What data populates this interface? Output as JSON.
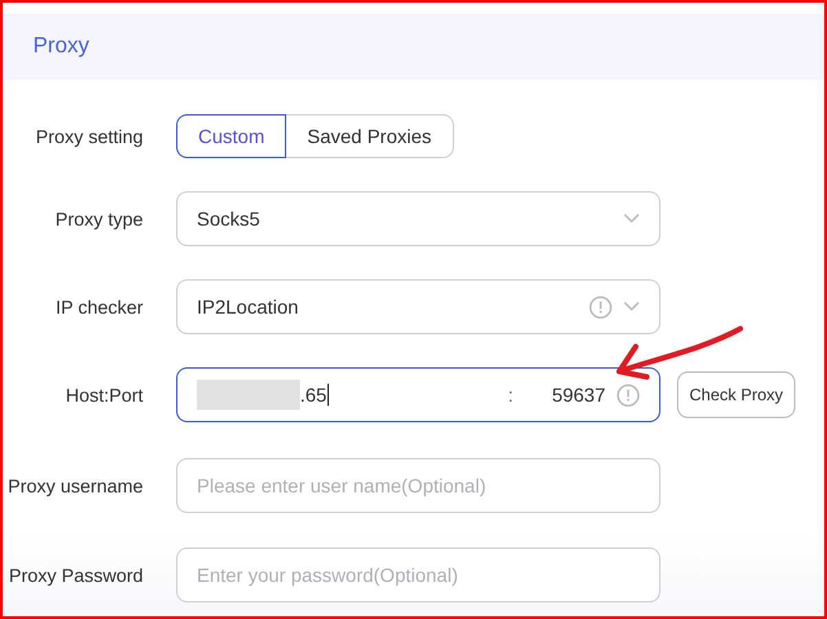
{
  "header": {
    "title": "Proxy"
  },
  "proxy_setting": {
    "label": "Proxy setting",
    "options": [
      {
        "label": "Custom",
        "selected": true
      },
      {
        "label": "Saved Proxies",
        "selected": false
      }
    ]
  },
  "proxy_type": {
    "label": "Proxy type",
    "value": "Socks5"
  },
  "ip_checker": {
    "label": "IP checker",
    "value": "IP2Location"
  },
  "host_port": {
    "label": "Host:Port",
    "host": ".65",
    "separator": ":",
    "port": "59637",
    "button": "Check Proxy"
  },
  "proxy_username": {
    "label": "Proxy username",
    "placeholder": "Please enter user name(Optional)"
  },
  "proxy_password": {
    "label": "Proxy Password",
    "placeholder": "Enter your password(Optional)"
  }
}
